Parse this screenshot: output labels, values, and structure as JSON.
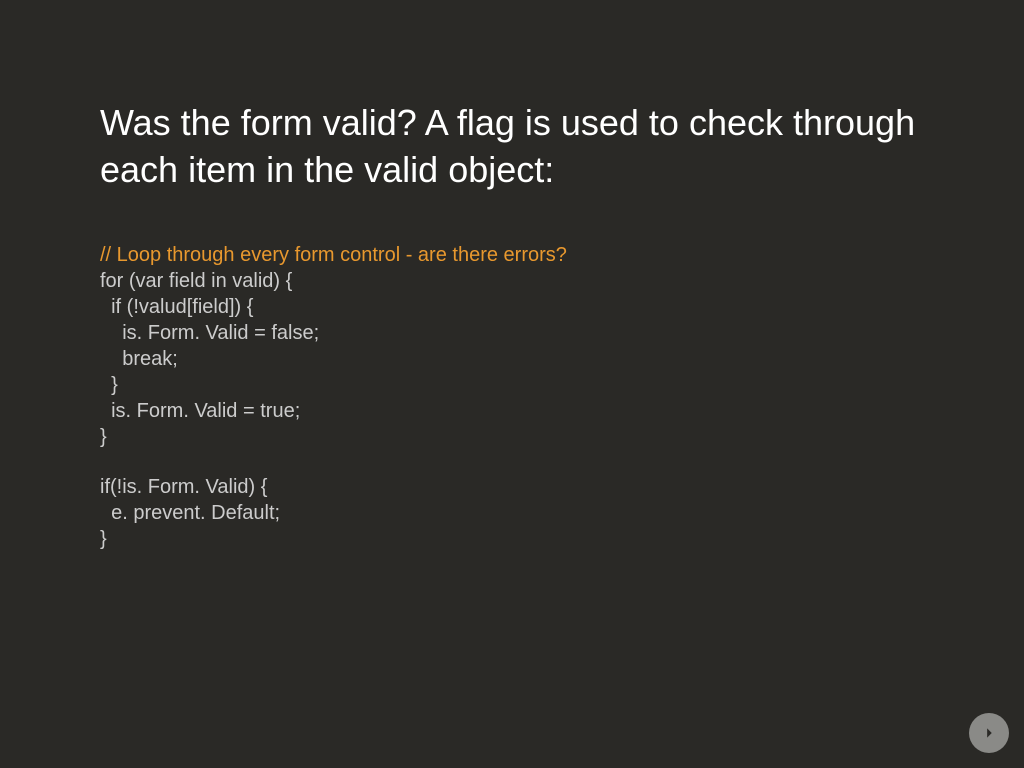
{
  "slide": {
    "title": "Was the form valid? A flag is used to check through each item in the valid object:",
    "code": {
      "comment": "// Loop through every form control - are there errors?",
      "lines": [
        "for (var field in valid) {",
        "  if (!valud[field]) {",
        "    is. Form. Valid = false;",
        "    break;",
        "  }",
        "  is. Form. Valid = true;",
        "}"
      ],
      "lines2": [
        "if(!is. Form. Valid) {",
        "  e. prevent. Default;",
        "}"
      ]
    }
  }
}
